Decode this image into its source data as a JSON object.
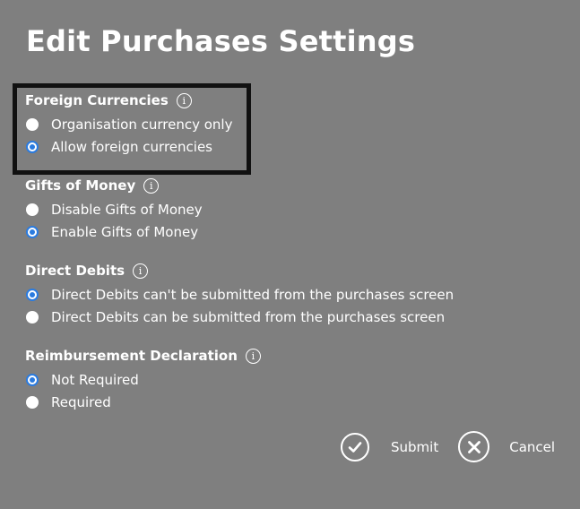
{
  "page": {
    "title": "Edit Purchases Settings"
  },
  "sections": [
    {
      "header": "Foreign Currencies",
      "options": [
        {
          "label": "Organisation currency only",
          "checked": false
        },
        {
          "label": "Allow foreign currencies",
          "checked": true
        }
      ]
    },
    {
      "header": "Gifts of Money",
      "options": [
        {
          "label": "Disable Gifts of Money",
          "checked": false
        },
        {
          "label": "Enable Gifts of Money",
          "checked": true
        }
      ]
    },
    {
      "header": "Direct Debits",
      "options": [
        {
          "label": "Direct Debits can't be submitted from the purchases screen",
          "checked": true
        },
        {
          "label": "Direct Debits can be submitted from the purchases screen",
          "checked": false
        }
      ]
    },
    {
      "header": "Reimbursement Declaration",
      "options": [
        {
          "label": "Not Required",
          "checked": true
        },
        {
          "label": "Required",
          "checked": false
        }
      ]
    }
  ],
  "actions": {
    "submit_label": "Submit",
    "cancel_label": "Cancel"
  },
  "icons": {
    "info": "info-icon",
    "submit": "check-circle-icon",
    "cancel": "x-circle-icon"
  },
  "colors": {
    "background": "#7f7f7f",
    "accent": "#2a7be0",
    "highlight_border": "#111111"
  }
}
